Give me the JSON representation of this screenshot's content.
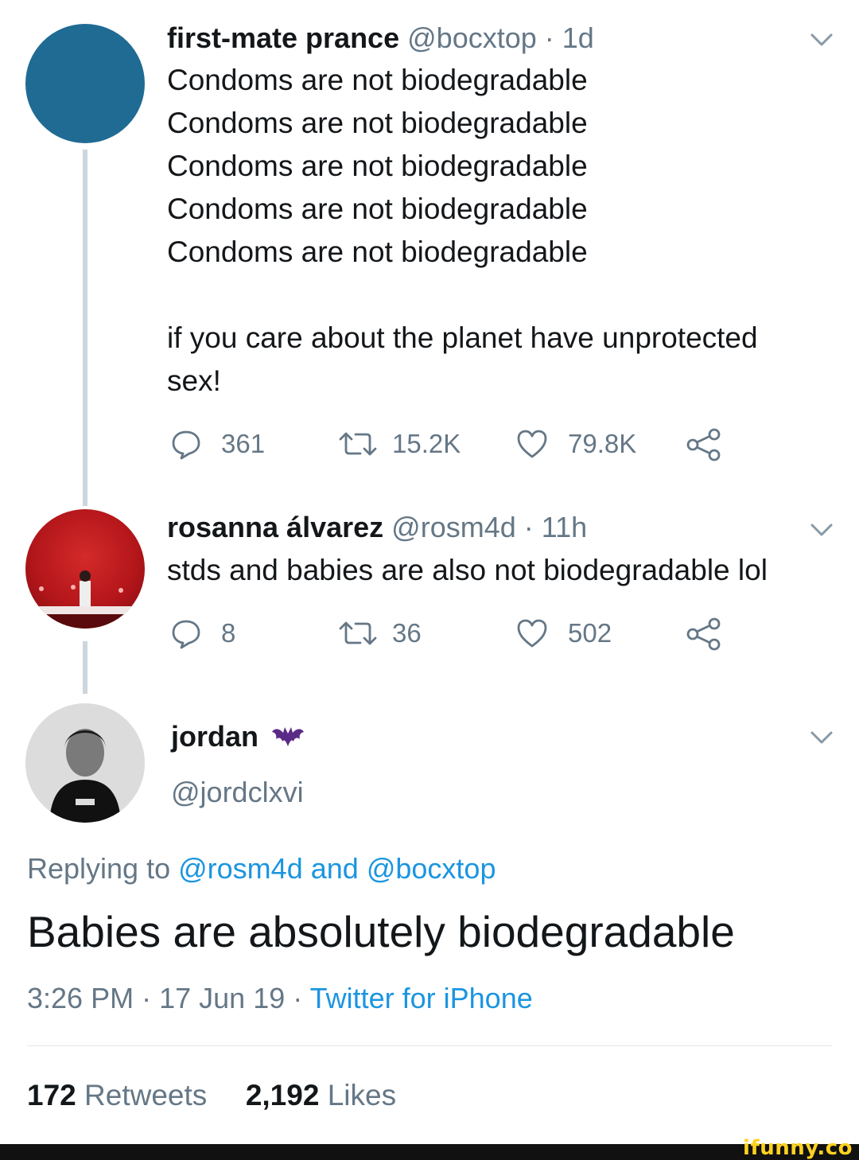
{
  "tweet1": {
    "name": "first-mate prance",
    "handle": "@bocxtop",
    "time": "· 1d",
    "avatar_color": "#1f6b93",
    "lines": [
      "Condoms are not biodegradable",
      "Condoms are not biodegradable",
      "Condoms are not biodegradable",
      "Condoms are not biodegradable",
      "Condoms are not biodegradable"
    ],
    "paragraph_line1": "if you care about the planet have unprotected",
    "paragraph_line2": "sex!",
    "actions": {
      "replies": "361",
      "retweets": "15.2K",
      "likes": "79.8K"
    }
  },
  "tweet2": {
    "name": "rosanna álvarez",
    "handle": "@rosm4d",
    "time": "· 11h",
    "avatar_color": "#b3161a",
    "text": "stds and babies are also not biodegradable lol",
    "actions": {
      "replies": "8",
      "retweets": "36",
      "likes": "502"
    }
  },
  "tweet3": {
    "name": "jordan",
    "name_emoji": "bat-emoji-icon",
    "handle": "@jordclxvi",
    "replying_prefix": "Replying to",
    "replying_user1": "@rosm4d",
    "replying_and": "and",
    "replying_user2": "@bocxtop",
    "text": "Babies are absolutely biodegradable",
    "time": "3:26 PM",
    "sep1": "·",
    "date": "17 Jun 19",
    "sep2": "·",
    "client": "Twitter for iPhone",
    "retweets_count": "172",
    "retweets_label": "Retweets",
    "likes_count": "2,192",
    "likes_label": "Likes"
  },
  "watermark": "ifunny.co",
  "colors": {
    "link": "#1b95e0",
    "secondary_text": "#657786",
    "primary_text": "#14171a",
    "thread_line": "#ccd6dd",
    "watermark": "#ffd21f"
  }
}
